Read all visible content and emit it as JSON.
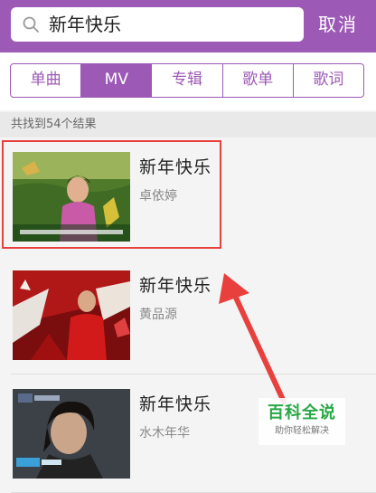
{
  "header": {
    "search_value": "新年快乐",
    "cancel_label": "取消"
  },
  "tabs": [
    {
      "label": "单曲",
      "active": false
    },
    {
      "label": "MV",
      "active": true
    },
    {
      "label": "专辑",
      "active": false
    },
    {
      "label": "歌单",
      "active": false
    },
    {
      "label": "歌词",
      "active": false
    }
  ],
  "result_count": "共找到54个结果",
  "results": [
    {
      "title": "新年快乐",
      "artist": "卓依婷"
    },
    {
      "title": "新年快乐",
      "artist": "黄品源"
    },
    {
      "title": "新年快乐",
      "artist": "水木年华"
    }
  ],
  "watermark": {
    "title": "百科全说",
    "subtitle": "助你轻松解决"
  },
  "colors": {
    "accent": "#9c59b6",
    "highlight": "#e8403d",
    "watermark_green": "#27a844"
  }
}
